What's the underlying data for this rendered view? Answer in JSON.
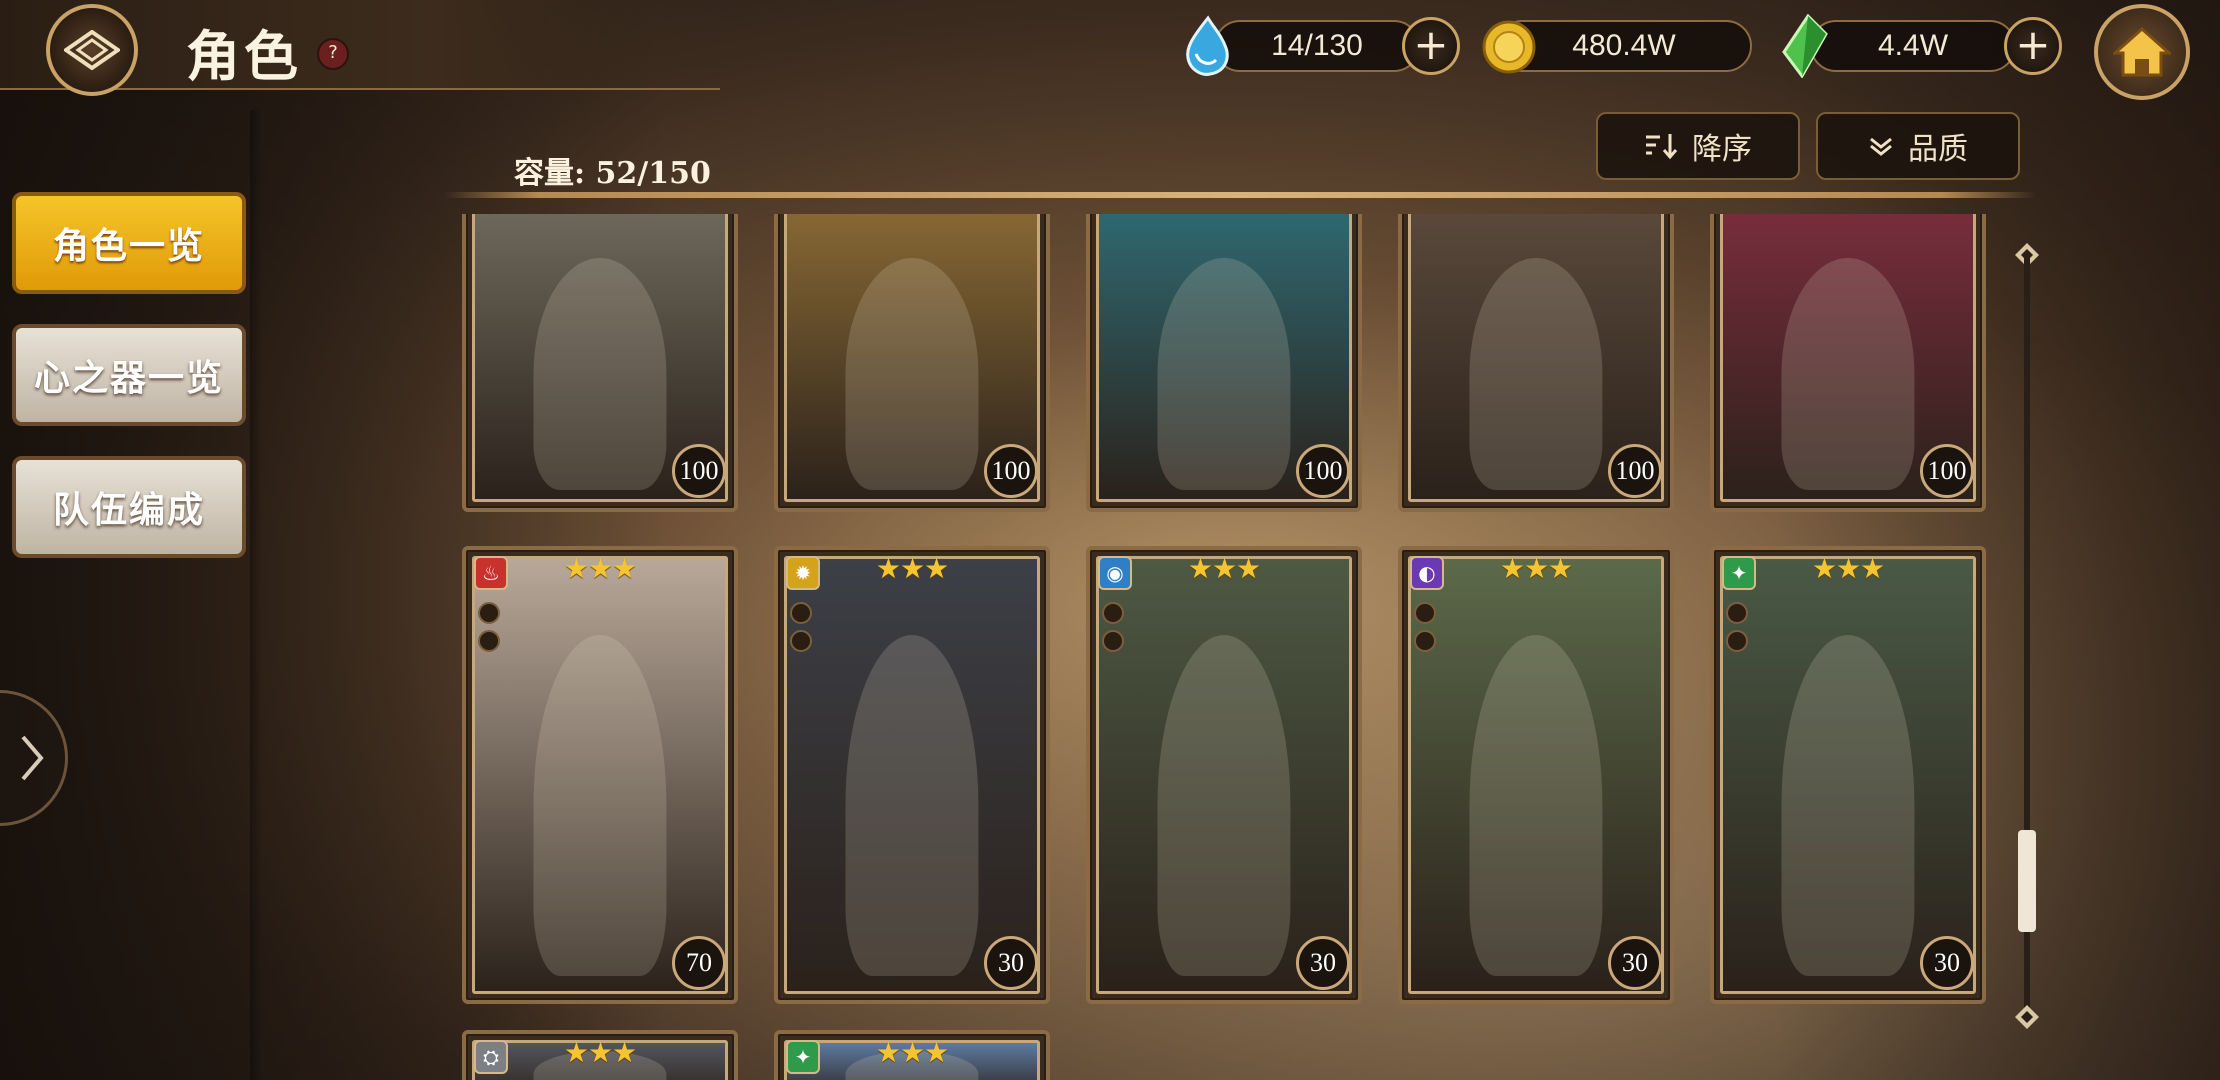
{
  "header": {
    "title": "角色",
    "help": "?"
  },
  "resources": [
    {
      "name": "stamina",
      "value": "14/130",
      "color": "#39a7e0"
    },
    {
      "name": "gold",
      "value": "480.4W",
      "color": "#e7b82a"
    },
    {
      "name": "gem",
      "value": "4.4W",
      "color": "#4ec24c"
    }
  ],
  "sort": {
    "order_label": "降序",
    "filter_label": "品质"
  },
  "capacity": "容量: 52/150",
  "nav": [
    {
      "label": "角色一览",
      "active": true
    },
    {
      "label": "心之器一览",
      "active": false
    },
    {
      "label": "队伍编成",
      "active": false
    }
  ],
  "cards": [
    {
      "level": "100",
      "stars": "",
      "element": "",
      "bg": "#6f6a5d"
    },
    {
      "level": "100",
      "stars": "",
      "element": "",
      "bg": "#8a6a35"
    },
    {
      "level": "100",
      "stars": "",
      "element": "",
      "bg": "#2f6a73"
    },
    {
      "level": "100",
      "stars": "",
      "element": "",
      "bg": "#5b4a3c"
    },
    {
      "level": "100",
      "stars": "",
      "element": "",
      "bg": "#7a2d3d"
    },
    {
      "level": "70",
      "stars": "★★★",
      "element": "fire",
      "bg": "#b9a99a"
    },
    {
      "level": "30",
      "stars": "★★★",
      "element": "light",
      "bg": "#3d4048"
    },
    {
      "level": "30",
      "stars": "★★★",
      "element": "water",
      "bg": "#4e5a44"
    },
    {
      "level": "30",
      "stars": "★★★",
      "element": "dark",
      "bg": "#5c6a4a"
    },
    {
      "level": "30",
      "stars": "★★★",
      "element": "wind",
      "bg": "#4a5a46"
    },
    {
      "level": "",
      "stars": "★★★",
      "element": "steel",
      "bg": "#545860"
    },
    {
      "level": "",
      "stars": "★★★",
      "element": "wind",
      "bg": "#5f7fa8"
    }
  ]
}
